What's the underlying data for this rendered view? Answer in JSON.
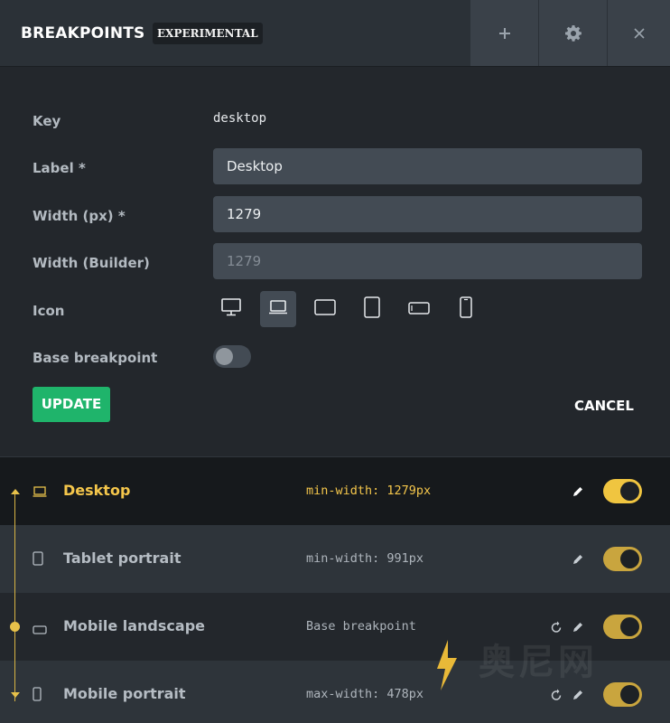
{
  "header": {
    "title": "BREAKPOINTS",
    "badge": "EXPERIMENTAL",
    "buttons": [
      {
        "icon": "plus-icon"
      },
      {
        "icon": "gear-icon"
      },
      {
        "icon": "close-icon"
      }
    ]
  },
  "form": {
    "key_label": "Key",
    "key_value": "desktop",
    "label_label": "Label *",
    "label_value": "Desktop",
    "width_label": "Width (px) *",
    "width_value": "1279",
    "width_builder_label": "Width (Builder)",
    "width_builder_placeholder": "1279",
    "icon_label": "Icon",
    "icons": [
      "desktop-icon",
      "laptop-icon",
      "tablet-landscape-icon",
      "tablet-portrait-icon",
      "mobile-landscape-icon",
      "mobile-portrait-icon"
    ],
    "selected_icon": "laptop-icon",
    "base_label": "Base breakpoint",
    "base_enabled": false,
    "update_label": "UPDATE",
    "cancel_label": "CANCEL"
  },
  "breakpoints": [
    {
      "name": "Desktop",
      "width": "min-width: 1279px",
      "icon": "laptop-icon",
      "active": true,
      "enabled": true
    },
    {
      "name": "Tablet portrait",
      "width": "min-width: 991px",
      "icon": "tablet-portrait-icon",
      "active": false,
      "enabled": true
    },
    {
      "name": "Mobile landscape",
      "width": "Base breakpoint",
      "icon": "mobile-landscape-icon",
      "active": false,
      "enabled": true
    },
    {
      "name": "Mobile portrait",
      "width": "max-width: 478px",
      "icon": "mobile-portrait-icon",
      "active": false,
      "enabled": true
    }
  ],
  "colors": {
    "accent": "#f0c540",
    "primary_button": "#1fb46b",
    "background": "#23272c",
    "header": "#2b3137",
    "input": "#434b54"
  },
  "watermark": {
    "text": "奥尼网"
  }
}
